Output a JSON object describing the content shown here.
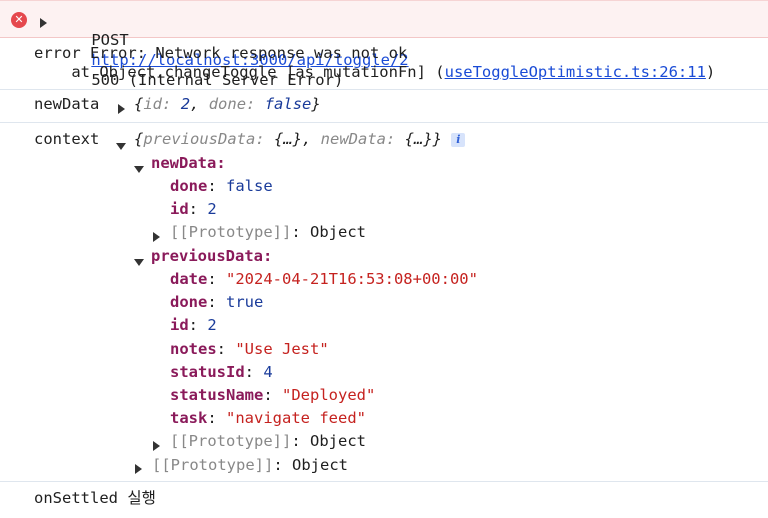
{
  "error_row": {
    "method": "POST",
    "url": "http://localhost:3000/api/toggle/2",
    "status": "500 (Internal Server Error)",
    "icon": "error-x-icon"
  },
  "error_message": {
    "line1": "error Error: Network response was not ok",
    "line2_prefix": "    at Object.changeToggle [as mutationFn] (",
    "line2_link": "useToggleOptimistic.ts:26:11",
    "line2_suffix": ")"
  },
  "newData_log": {
    "label": "newData",
    "preview_open": "{",
    "k1": "id",
    "v1": "2",
    "k2": "done",
    "v2": "false",
    "preview_close": "}"
  },
  "context_log": {
    "label": "context",
    "preview": "{previousData: {…}, newData: {…}}",
    "preview_k1": "previousData",
    "preview_v1": "{…}",
    "preview_k2": "newData",
    "preview_v2": "{…}",
    "info": "i",
    "newData": {
      "label": "newData",
      "done_key": "done",
      "done_val": "false",
      "id_key": "id",
      "id_val": "2",
      "proto": "[[Prototype]]",
      "proto_val": "Object"
    },
    "previousData": {
      "label": "previousData",
      "date_key": "date",
      "date_val": "\"2024-04-21T16:53:08+00:00\"",
      "done_key": "done",
      "done_val": "true",
      "id_key": "id",
      "id_val": "2",
      "notes_key": "notes",
      "notes_val": "\"Use Jest\"",
      "statusId_key": "statusId",
      "statusId_val": "4",
      "statusName_key": "statusName",
      "statusName_val": "\"Deployed\"",
      "task_key": "task",
      "task_val": "\"navigate feed\"",
      "proto": "[[Prototype]]",
      "proto_val": "Object"
    },
    "proto": "[[Prototype]]",
    "proto_val": "Object"
  },
  "settled_log": {
    "text": "onSettled 실행"
  }
}
